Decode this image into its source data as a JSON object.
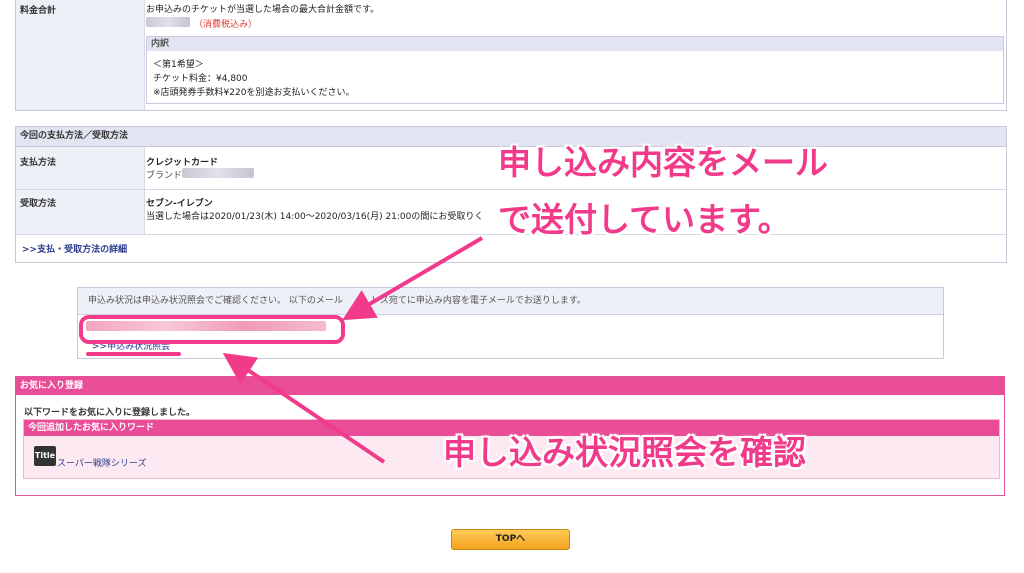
{
  "price": {
    "label": "料金合計",
    "description": "お申込みのチケットが当選した場合の最大合計金額です。",
    "tax_note": "（消費税込み）",
    "breakdown": {
      "title": "内訳",
      "lines": [
        "＜第1希望＞",
        "チケット料金：¥4,800",
        "※店頭発券手数料¥220を別途お支払いください。"
      ]
    }
  },
  "payment": {
    "header": "今回の支払方法／受取方法",
    "pay_label": "支払方法",
    "pay_method": "クレジットカード",
    "brand_label": "ブランド",
    "receive_label": "受取方法",
    "receive_method": "セブン-イレブン",
    "receive_note": "当選した場合は2020/01/23(木) 14:00〜2020/03/16(月) 21:00の間にお受取りく",
    "details_link": ">>支払・受取方法の詳細"
  },
  "status": {
    "notice": "申込み状況は申込み状況照会でご確認ください。 以下のメール",
    "notice_tail": "レス宛てに申込み内容を電子メールでお送りします。",
    "link": ">>申込み状況照会"
  },
  "favorites": {
    "header": "お気に入り登録",
    "message": "以下ワードをお気に入りに登録しました。",
    "added_header": "今回追加したお気に入りワード",
    "icon_text": "Title",
    "word": "スーパー戦隊シリーズ"
  },
  "top_button": "TOPへ",
  "annotations": {
    "mail_line1": "申し込み内容をメール",
    "mail_line2": "で送付しています。",
    "check": "申し込み状況照会を確認"
  },
  "colors": {
    "accent_pink": "#f13a8a",
    "header_pink": "#ea4d98",
    "button_orange": "#f3a21c"
  }
}
